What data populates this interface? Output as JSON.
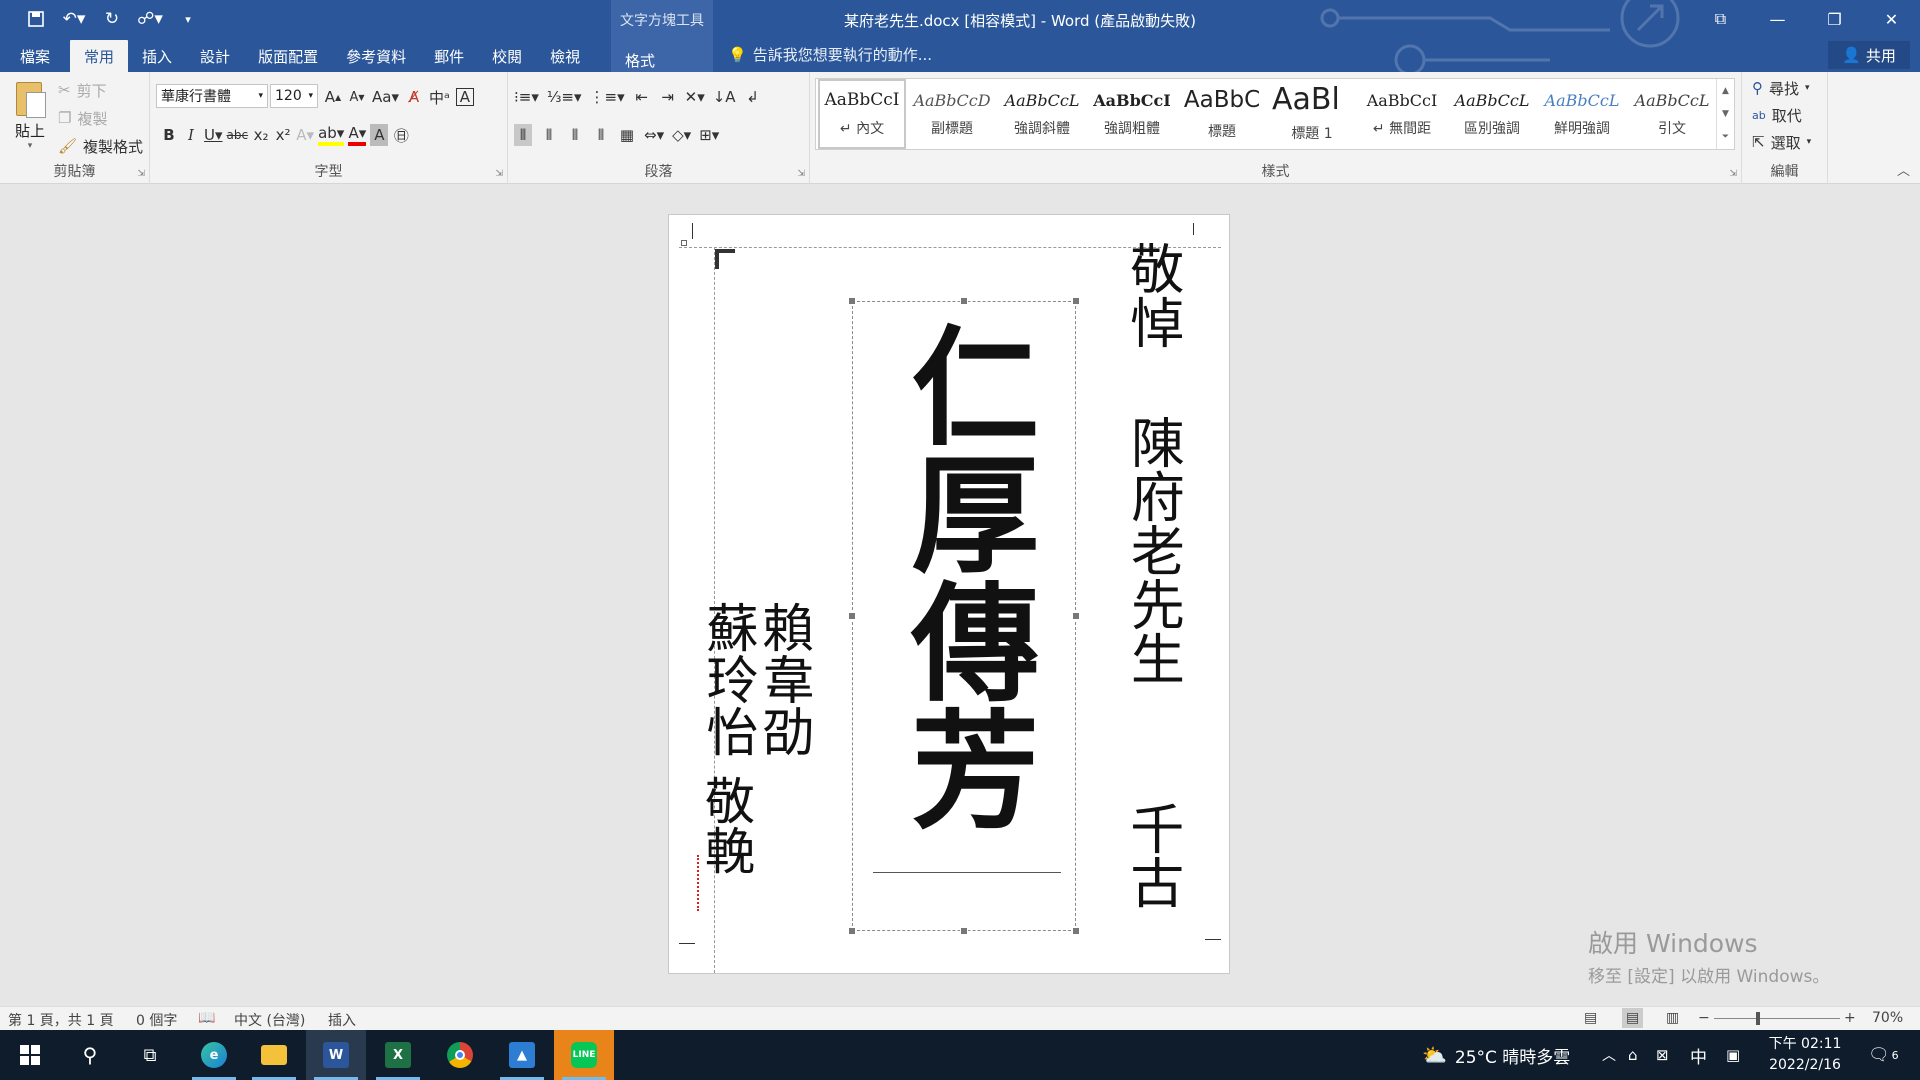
{
  "window": {
    "title": "某府老先生.docx [相容模式] - Word (產品啟動失敗)",
    "context_tool_label": "文字方塊工具",
    "context_tab": "格式",
    "tell_me": "告訴我您想要執行的動作...",
    "share": "共用"
  },
  "tabs": [
    "檔案",
    "常用",
    "插入",
    "設計",
    "版面配置",
    "參考資料",
    "郵件",
    "校閱",
    "檢視"
  ],
  "active_tab": "常用",
  "ribbon": {
    "clipboard": {
      "label": "剪貼簿",
      "paste": "貼上",
      "cut": "剪下",
      "copy": "複製",
      "format_painter": "複製格式"
    },
    "font": {
      "label": "字型",
      "font_name": "華康行書體",
      "font_size": "120",
      "case": "Aa"
    },
    "paragraph": {
      "label": "段落"
    },
    "styles": {
      "label": "樣式",
      "items": [
        {
          "preview": "AaBbCcI",
          "name": "↵ 內文"
        },
        {
          "preview": "AaBbCcD",
          "name": "副標題"
        },
        {
          "preview": "AaBbCcL",
          "name": "強調斜體"
        },
        {
          "preview": "AaBbCcI",
          "name": "強調粗體"
        },
        {
          "preview": "AaBbC",
          "name": "標題"
        },
        {
          "preview": "AaBl",
          "name": "標題 1"
        },
        {
          "preview": "AaBbCcI",
          "name": "↵ 無間距"
        },
        {
          "preview": "AaBbCcL",
          "name": "區別強調"
        },
        {
          "preview": "AaBbCcL",
          "name": "鮮明強調"
        },
        {
          "preview": "AaBbCcL",
          "name": "引文"
        }
      ]
    },
    "editing": {
      "label": "編輯",
      "find": "尋找",
      "replace": "取代",
      "select": "選取"
    }
  },
  "document": {
    "right_top": "敬悼",
    "right_name": "陳府老先生",
    "right_bottom": "千古",
    "center": "仁厚傳芳",
    "left_col1": "賴韋劭",
    "left_col2": "蘇玲怡",
    "left_bottom": "敬輓"
  },
  "watermark": {
    "line1": "啟用 Windows",
    "line2": "移至 [設定] 以啟用 Windows。"
  },
  "statusbar": {
    "page": "第 1 頁，共 1 頁",
    "words": "0 個字",
    "language": "中文 (台灣)",
    "mode": "插入",
    "zoom": "70%"
  },
  "taskbar": {
    "weather": "25°C  晴時多雲",
    "ime": "中",
    "time": "下午 02:11",
    "date": "2022/2/16",
    "notifications": "6"
  },
  "colors": {
    "accent": "#2b579a",
    "taskbar": "#0e1c2c"
  }
}
